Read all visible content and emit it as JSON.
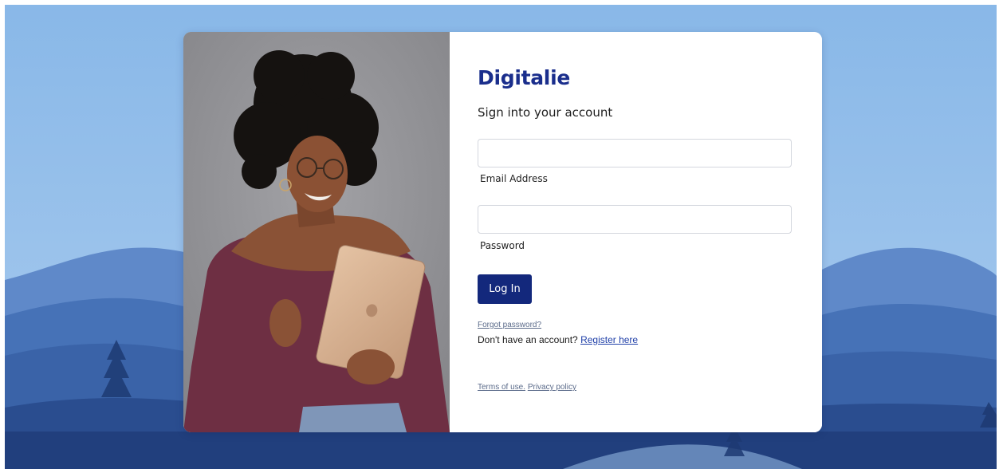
{
  "brand": {
    "name": "Digitalie",
    "color": "#1a2e8c"
  },
  "form": {
    "subtitle": "Sign into your account",
    "email": {
      "value": "",
      "label": "Email Address"
    },
    "password": {
      "value": "",
      "label": "Password"
    },
    "login_button": "Log In",
    "forgot_password": "Forgot password?",
    "register_prompt": "Don't have an account?",
    "register_link": "Register here"
  },
  "footer": {
    "terms": "Terms of use.",
    "privacy": "Privacy policy"
  },
  "colors": {
    "button": "#13287c",
    "sky": "#8fb9e6",
    "mountains": "#2a4d8f"
  }
}
